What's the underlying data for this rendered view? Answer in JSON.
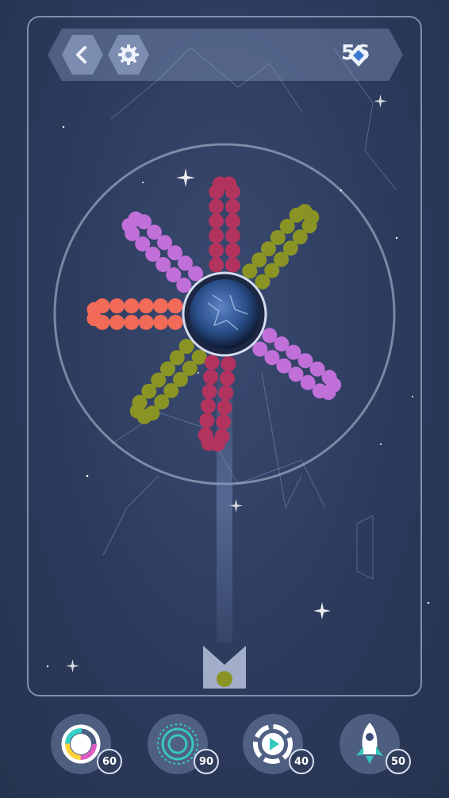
{
  "header": {
    "back_icon": "chevron-left-icon",
    "settings_icon": "gear-icon",
    "gem_count": "56",
    "gem_icon": "diamond-icon"
  },
  "colors": {
    "magenta": "#b3335f",
    "olive": "#8a9425",
    "violet": "#c070d8",
    "coral": "#f26a58"
  },
  "shooter": {
    "next_ball_color": "#8a9425"
  },
  "powerups": [
    {
      "name": "rainbow",
      "icon": "rainbow-ring-icon",
      "count": "60"
    },
    {
      "name": "target",
      "icon": "target-ring-icon",
      "count": "90"
    },
    {
      "name": "play",
      "icon": "play-circle-icon",
      "count": "40"
    },
    {
      "name": "rocket",
      "icon": "rocket-icon",
      "count": "50"
    }
  ]
}
